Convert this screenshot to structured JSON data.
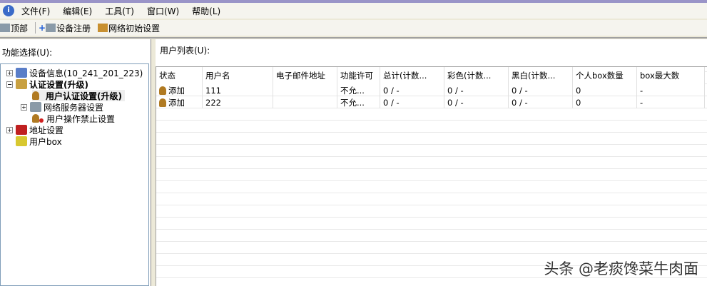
{
  "menu": [
    "文件(F)",
    "编辑(E)",
    "工具(T)",
    "窗口(W)",
    "帮助(L)"
  ],
  "toolbar": [
    "顶部",
    "设备注册",
    "网络初始设置"
  ],
  "left": {
    "label": "功能选择(U):",
    "tree": [
      "设备信息(10_241_201_223)",
      "认证设置(升级)",
      "用户认证设置(升级)",
      "网络服务器设置",
      "用户操作禁止设置",
      "地址设置",
      "用户box"
    ]
  },
  "right": {
    "label": "用户列表(U):",
    "columns": [
      "状态",
      "用户名",
      "电子邮件地址",
      "功能许可",
      "总计(计数...",
      "彩色(计数...",
      "黑白(计数...",
      "个人box数量",
      "box最大数"
    ],
    "rows": [
      [
        "添加",
        "111",
        "",
        "不允...",
        "0 / -",
        "0 / -",
        "0 / -",
        "0",
        "-"
      ],
      [
        "添加",
        "222",
        "",
        "不允...",
        "0 / -",
        "0 / -",
        "0 / -",
        "0",
        "-"
      ]
    ]
  },
  "watermark": "头条 @老痰馋菜牛肉面"
}
